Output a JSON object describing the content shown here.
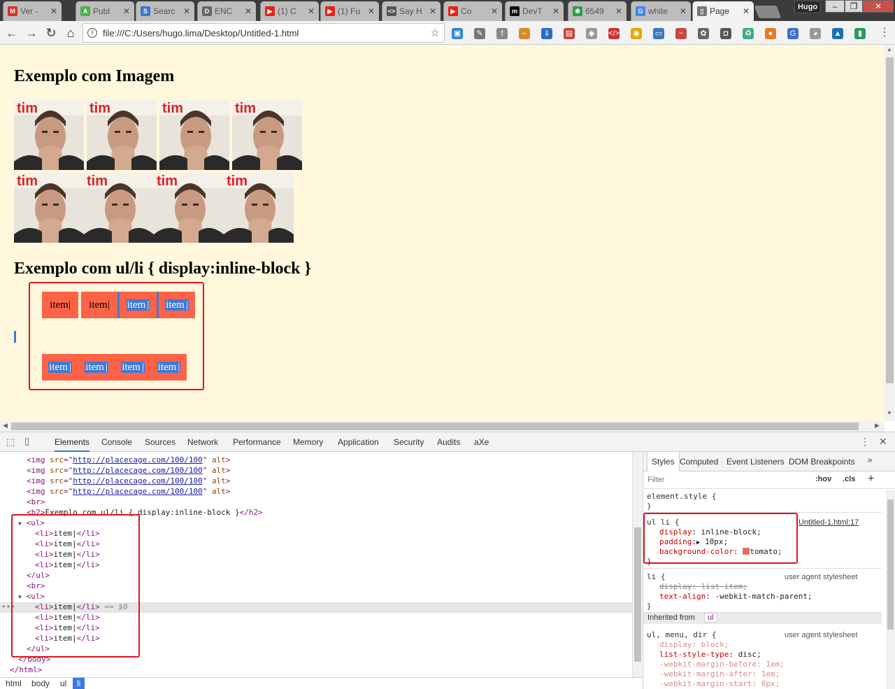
{
  "tabs": [
    {
      "title": "Ver -",
      "icon": "gmail-icon",
      "color": "#d93025",
      "glyph": "M"
    },
    {
      "title": "Publ",
      "icon": "android-icon",
      "color": "#4caf50",
      "glyph": "A"
    },
    {
      "title": "Searc",
      "icon": "search-page-icon",
      "color": "#3b78c6",
      "glyph": "S"
    },
    {
      "title": "ENC",
      "icon": "document-icon",
      "color": "#666666",
      "glyph": "D"
    },
    {
      "title": "(1) C",
      "icon": "youtube-icon",
      "color": "#e62117",
      "glyph": "▶"
    },
    {
      "title": "(1) Fu",
      "icon": "youtube-icon",
      "color": "#e62117",
      "glyph": "▶"
    },
    {
      "title": "Say H",
      "icon": "code-icon",
      "color": "#555555",
      "glyph": "<>"
    },
    {
      "title": "Co",
      "icon": "youtube-icon",
      "color": "#e62117",
      "glyph": "▶"
    },
    {
      "title": "DevT",
      "icon": "medium-icon",
      "color": "#111111",
      "glyph": "m"
    },
    {
      "title": "6549",
      "icon": "bug-icon",
      "color": "#2e9e44",
      "glyph": "✱"
    },
    {
      "title": "white",
      "icon": "google-icon",
      "color": "#4285f4",
      "glyph": "G"
    },
    {
      "title": "Page",
      "icon": "page-icon",
      "color": "#777777",
      "glyph": "▯"
    }
  ],
  "window": {
    "user": "Hugo"
  },
  "address": {
    "url": "file:///C:/Users/hugo.lima/Desktop/Untitled-1.html"
  },
  "page": {
    "heading1": "Exemplo com Imagem",
    "heading2": "Exemplo com ul/li { display:inline-block }",
    "item_label": "item"
  },
  "devtools": {
    "tabs": [
      "Elements",
      "Console",
      "Sources",
      "Network",
      "Performance",
      "Memory",
      "Application",
      "Security",
      "Audits",
      "aXe"
    ],
    "img_src": "http://placecage.com/100/100",
    "h2_text": "Exemplo com ul/li { display:inline-block }",
    "selected_marker": "== $0",
    "breadcrumbs": [
      "html",
      "body",
      "ul",
      "li"
    ],
    "styles_tabs": [
      "Styles",
      "Computed",
      "Event Listeners",
      "DOM Breakpoints"
    ],
    "filter_placeholder": "Filter",
    "hov": ":hov",
    "cls": ".cls",
    "rules": {
      "element_style": "element.style {",
      "ul_li_selector": "ul li {",
      "ul_li_source": "Untitled-1.html:17",
      "display": "inline-block;",
      "padding": "10px;",
      "background": "tomato;",
      "li_selector": "li {",
      "ua": "user agent stylesheet",
      "li_display": "display: list-item;",
      "li_text_align": "-webkit-match-parent;",
      "inherited_from": "Inherited from",
      "inherited_tag": "ul",
      "ul_selector": "ul, menu, dir {",
      "ul_display": "display: block;",
      "list_style": "disc;",
      "margin_before": "-webkit-margin-before: 1em;",
      "margin_after": "-webkit-margin-after: 1em;",
      "margin_start": "-webkit-margin-start: 0px;"
    }
  },
  "colors": {
    "tomato": "#ff6347",
    "highlight": "#e0141b",
    "page_bg": "#fff8dc"
  }
}
